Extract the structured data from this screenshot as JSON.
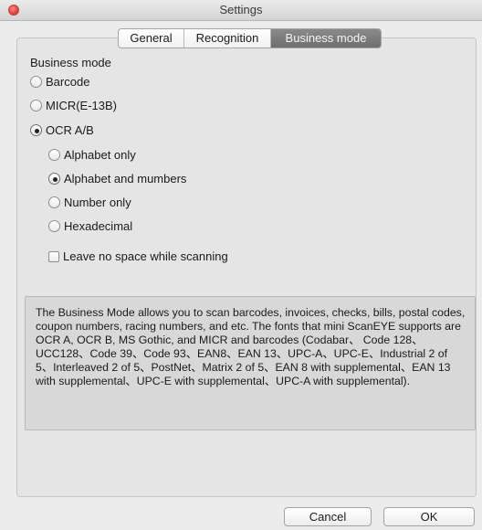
{
  "window": {
    "title": "Settings"
  },
  "tabs": [
    {
      "label": "General"
    },
    {
      "label": "Recognition"
    },
    {
      "label": "Business mode"
    }
  ],
  "business_mode": {
    "heading": "Business mode",
    "options": [
      {
        "label": "Barcode",
        "checked": false
      },
      {
        "label": "MICR(E-13B)",
        "checked": false
      },
      {
        "label": "OCR A/B",
        "checked": true
      }
    ],
    "ocr_options": [
      {
        "label": "Alphabet only",
        "checked": false
      },
      {
        "label": "Alphabet and mumbers",
        "checked": true
      },
      {
        "label": "Number only",
        "checked": false
      },
      {
        "label": "Hexadecimal",
        "checked": false
      }
    ],
    "leave_no_space": {
      "label": "Leave no space while scanning",
      "checked": false
    }
  },
  "description": "The Business Mode allows you to scan barcodes, invoices, checks, bills, postal codes, coupon numbers, racing numbers, and etc. The fonts that mini ScanEYE supports are OCR A, OCR B, MS Gothic, and MICR and barcodes (Codabar、 Code 128、UCC128、Code 39、Code 93、EAN8、EAN 13、UPC-A、UPC-E、Industrial 2 of 5、Interleaved 2 of 5、PostNet、Matrix 2 of 5、EAN 8 with supplemental、EAN 13 with supplemental、UPC-E with supplemental、UPC-A with supplemental).",
  "buttons": {
    "cancel": "Cancel",
    "ok": "OK"
  }
}
